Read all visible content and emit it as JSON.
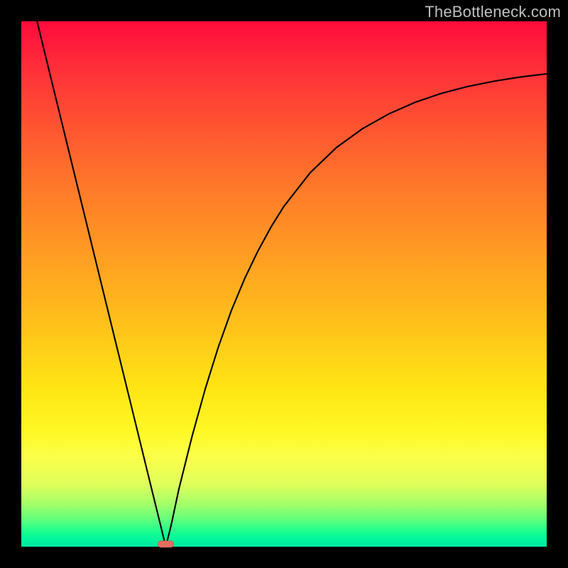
{
  "watermark": "TheBottleneck.com",
  "chart_data": {
    "type": "line",
    "title": "",
    "xlabel": "",
    "ylabel": "",
    "xlim": [
      0,
      100
    ],
    "ylim": [
      0,
      100
    ],
    "grid": false,
    "legend": false,
    "annotations": [],
    "marker": {
      "x": 27.5,
      "y": 0.5,
      "color": "#e07060"
    },
    "series": [
      {
        "name": "curve",
        "color": "#000000",
        "x": [
          3.0,
          5.0,
          7.5,
          10.0,
          12.5,
          15.0,
          17.5,
          20.0,
          22.5,
          25.0,
          26.5,
          27.5,
          28.5,
          30.0,
          32.5,
          35.0,
          37.5,
          40.0,
          42.5,
          45.0,
          47.5,
          50.0,
          55.0,
          60.0,
          65.0,
          70.0,
          75.0,
          80.0,
          85.0,
          90.0,
          95.0,
          100.0
        ],
        "y": [
          100.0,
          91.8,
          81.6,
          71.4,
          61.2,
          51.0,
          40.8,
          30.6,
          20.4,
          10.2,
          4.1,
          0.0,
          4.0,
          11.0,
          21.0,
          30.0,
          38.0,
          45.0,
          51.0,
          56.2,
          60.8,
          64.8,
          71.2,
          76.0,
          79.6,
          82.4,
          84.6,
          86.3,
          87.6,
          88.6,
          89.4,
          90.0
        ]
      }
    ]
  }
}
